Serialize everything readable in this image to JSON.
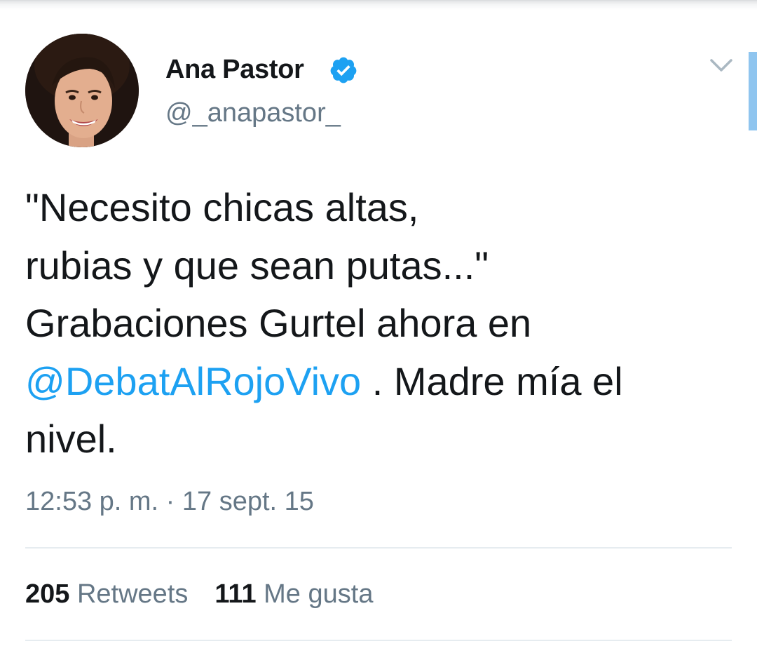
{
  "tweet": {
    "author": {
      "name": "Ana Pastor",
      "handle": "@_anapastor_",
      "verified": true,
      "avatar_icon": "profile-photo"
    },
    "text_line1": "\"Necesito chicas altas,",
    "text_line2": "rubias y que sean putas...\"",
    "text_line3": "Grabaciones Gurtel ahora en",
    "mention": "@DebatAlRojoVivo",
    "text_after_mention": " . Madre mía el",
    "text_line5": "nivel.",
    "timestamp": "12:53 p. m. · 17 sept. 15",
    "stats": {
      "retweets_count": "205",
      "retweets_label": "Retweets",
      "likes_count": "111",
      "likes_label": "Me gusta"
    }
  },
  "colors": {
    "text": "#14171a",
    "secondary": "#657786",
    "link": "#1da1f2",
    "divider": "#e6ecf0"
  },
  "icons": {
    "verified": "verified-badge-icon",
    "menu": "chevron-down-icon"
  }
}
